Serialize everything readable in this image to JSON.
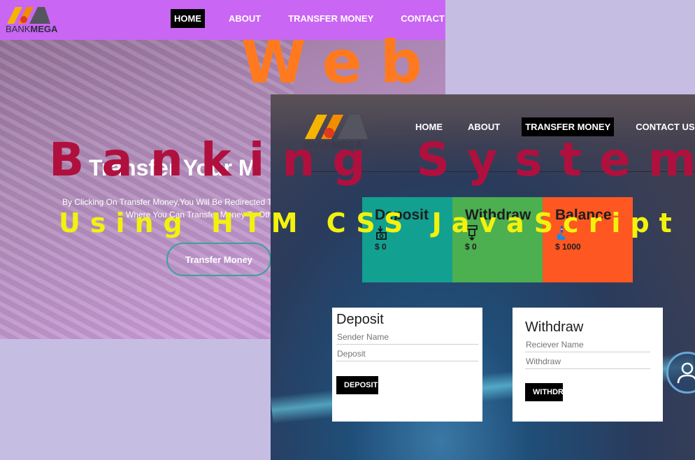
{
  "overlay": {
    "line1": "Web",
    "line2": "Banking System",
    "line3": "Using HTM CSS JavaScript",
    "colors": {
      "line1": "#ff7a1f",
      "line2": "#b0103e",
      "line3": "#f2f20d"
    }
  },
  "screen1": {
    "logo": {
      "icon": "bankmega-logo-icon",
      "brand_regular": "BANK",
      "brand_bold": "MEGA"
    },
    "nav": {
      "home": "HOME",
      "about": "ABOUT",
      "transfer": "TRANSFER MONEY",
      "contact": "CONTACT US",
      "active": "HOME"
    },
    "hero": {
      "title": "Transfer Your M",
      "text_line1": "By Clicking On Transfer Money,You Will Be Redirected T",
      "text_line2": "Where You Can Transfer Money To Oth",
      "cta": "Transfer Money"
    },
    "colors": {
      "navbar": "#c966f4",
      "cta_border": "#3aa39a"
    }
  },
  "screen2": {
    "logo": {
      "icon": "bankmega-logo-icon",
      "brand_regular": "BANK",
      "brand_bold": "MEGA"
    },
    "nav": {
      "home": "HOME",
      "about": "ABOUT",
      "transfer": "TRANSFER MONEY",
      "contact": "CONTACT US",
      "active": "TRANSFER MONEY"
    },
    "cards": [
      {
        "title": "Deposit",
        "icon": "cash-deposit-icon",
        "value": "$ 0",
        "color": "#12a091"
      },
      {
        "title": "Withdraw",
        "icon": "atm-withdraw-icon",
        "value": "$ 0",
        "color": "#4caf50"
      },
      {
        "title": "Balance",
        "icon": "balance-person-icon",
        "value": "$ 1000",
        "color": "#ff5722"
      }
    ],
    "deposit_form": {
      "title": "Deposit",
      "sender_placeholder": "Sender Name",
      "amount_placeholder": "Deposit",
      "button": "DEPOSIT"
    },
    "withdraw_form": {
      "title": "Withdraw",
      "receiver_placeholder": "Reciever Name",
      "amount_placeholder": "Withdraw",
      "button": "WITHDRAW"
    },
    "avatar_icon": "user-avatar-icon"
  }
}
